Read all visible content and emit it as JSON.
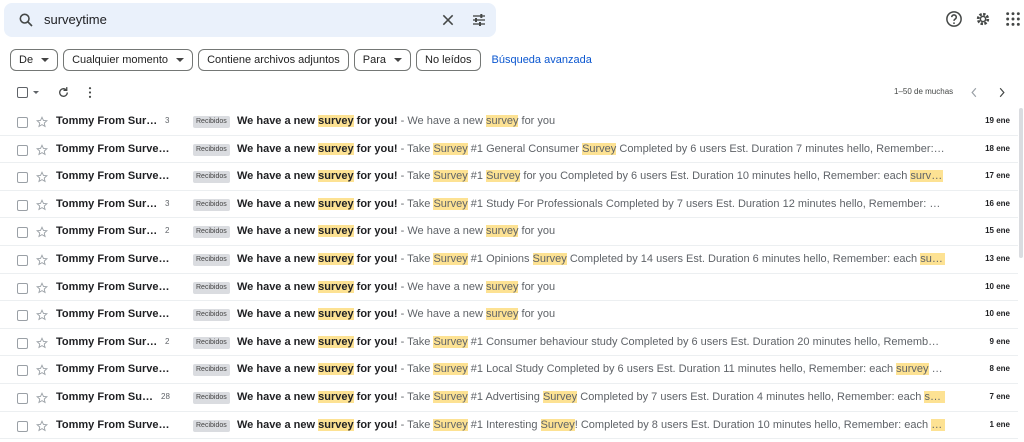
{
  "search": {
    "query": "surveytime"
  },
  "filters": {
    "chips": [
      {
        "label": "De",
        "dropdown": true
      },
      {
        "label": "Cualquier momento",
        "dropdown": true
      },
      {
        "label": "Contiene archivos adjuntos",
        "dropdown": false
      },
      {
        "label": "Para",
        "dropdown": true
      },
      {
        "label": "No leídos",
        "dropdown": false
      }
    ],
    "advanced_link": "Búsqueda avanzada"
  },
  "pager": {
    "text": "1–50 de muchas"
  },
  "colors": {
    "highlight": "#fde293",
    "accent": "#0b57d0",
    "search_bg": "#eaf1fb"
  },
  "label_name": "Recibidos",
  "emails": [
    {
      "sender": "Tommy From Surve...",
      "count": "3",
      "subject": "We have a new survey for you!",
      "snippet": " - We have a new survey for you",
      "date": "19 ene"
    },
    {
      "sender": "Tommy From Surveyti.",
      "count": "",
      "subject": "We have a new survey for you!",
      "snippet": " - Take Survey #1 General Consumer Survey Completed by 6 users Est. Duration 7 minutes hello, Remember: each survey ...",
      "date": "18 ene"
    },
    {
      "sender": "Tommy From Surveyti.",
      "count": "",
      "subject": "We have a new survey for you!",
      "snippet": " - Take Survey #1 Survey for you Completed by 6 users Est. Duration 10 minutes hello, Remember: each survey you compl...",
      "date": "17 ene"
    },
    {
      "sender": "Tommy From Surve...",
      "count": "3",
      "subject": "We have a new survey for you!",
      "snippet": " - Take Survey #1 Study For Professionals Completed by 7 users Est. Duration 12 minutes hello, Remember: each survey y...",
      "date": "16 ene"
    },
    {
      "sender": "Tommy From Surve...",
      "count": "2",
      "subject": "We have a new survey for you!",
      "snippet": " - We have a new survey for you",
      "date": "15 ene"
    },
    {
      "sender": "Tommy From Surveyti.",
      "count": "",
      "subject": "We have a new survey for you!",
      "snippet": " - Take Survey #1 Opinions Survey Completed by 14 users Est. Duration 6 minutes hello, Remember: each survey you com...",
      "date": "13 ene"
    },
    {
      "sender": "Tommy From Surveyti.",
      "count": "",
      "subject": "We have a new survey for you!",
      "snippet": " - We have a new survey for you",
      "date": "10 ene"
    },
    {
      "sender": "Tommy From Surveyti.",
      "count": "",
      "subject": "We have a new survey for you!",
      "snippet": " - We have a new survey for you",
      "date": "10 ene"
    },
    {
      "sender": "Tommy From Surve...",
      "count": "2",
      "subject": "We have a new survey for you!",
      "snippet": " - Take Survey #1 Consumer behaviour study Completed by 6 users Est. Duration 20 minutes hello, Remember: each surve...",
      "date": "9 ene"
    },
    {
      "sender": "Tommy From Surveyti.",
      "count": "",
      "subject": "We have a new survey for you!",
      "snippet": " - Take Survey #1 Local Study Completed by 6 users Est. Duration 11 minutes hello, Remember: each survey you complete ...",
      "date": "8 ene"
    },
    {
      "sender": "Tommy From Surv...",
      "count": "28",
      "subject": "We have a new survey for you!",
      "snippet": " - Take Survey #1 Advertising Survey Completed by 7 users Est. Duration 4 minutes hello, Remember: each survey you co...",
      "date": "7 ene"
    },
    {
      "sender": "Tommy From Surveyti.",
      "count": "",
      "subject": "We have a new survey for you!",
      "snippet": " - Take Survey #1 Interesting Survey! Completed by 8 users Est. Duration 10 minutes hello, Remember: each survey you co...",
      "date": "1 ene"
    }
  ]
}
